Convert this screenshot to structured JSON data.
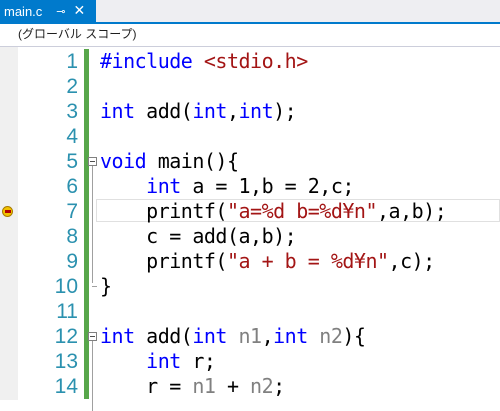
{
  "tab": {
    "name": "main.c",
    "pin_icon": "pin-icon",
    "close_icon": "close-icon"
  },
  "scope": {
    "label": "(グローバル スコープ)"
  },
  "colors": {
    "keyword": "#0000ff",
    "string": "#a31515",
    "line_number": "#2b91af",
    "change_bar": "#57a64a",
    "accent": "#007acc"
  },
  "editor": {
    "lines": [
      {
        "num": "1",
        "code": "#include <stdio.h>",
        "parts": [
          {
            "t": "#include ",
            "c": "kw"
          },
          {
            "t": "<stdio.h>",
            "c": "str"
          }
        ]
      },
      {
        "num": "2",
        "code": "",
        "parts": []
      },
      {
        "num": "3",
        "code": "int add(int,int);",
        "parts": [
          {
            "t": "int",
            "c": "kw"
          },
          {
            "t": " add(",
            "c": ""
          },
          {
            "t": "int",
            "c": "kw"
          },
          {
            "t": ",",
            "c": ""
          },
          {
            "t": "int",
            "c": "kw"
          },
          {
            "t": ");",
            "c": ""
          }
        ]
      },
      {
        "num": "4",
        "code": "",
        "parts": []
      },
      {
        "num": "5",
        "code": "void main(){",
        "parts": [
          {
            "t": "void",
            "c": "kw"
          },
          {
            "t": " main(){",
            "c": ""
          }
        ],
        "fold": true
      },
      {
        "num": "6",
        "code": "    int a = 1,b = 2,c;",
        "parts": [
          {
            "t": "    ",
            "c": ""
          },
          {
            "t": "int",
            "c": "kw"
          },
          {
            "t": " a = 1,b = 2,c;",
            "c": ""
          }
        ]
      },
      {
        "num": "7",
        "code": "    printf(\"a=%d b=%d¥n\",a,b);",
        "parts": [
          {
            "t": "    printf(",
            "c": ""
          },
          {
            "t": "\"a=%d b=%d¥n\"",
            "c": "str"
          },
          {
            "t": ",a,b);",
            "c": ""
          }
        ],
        "breakpoint": true,
        "current": true
      },
      {
        "num": "8",
        "code": "    c = add(a,b);",
        "parts": [
          {
            "t": "    c = add(a,b);",
            "c": ""
          }
        ]
      },
      {
        "num": "9",
        "code": "    printf(\"a + b = %d¥n\",c);",
        "parts": [
          {
            "t": "    printf(",
            "c": ""
          },
          {
            "t": "\"a + b = %d¥n\"",
            "c": "str"
          },
          {
            "t": ",c);",
            "c": ""
          }
        ]
      },
      {
        "num": "10",
        "code": "}",
        "parts": [
          {
            "t": "}",
            "c": ""
          }
        ]
      },
      {
        "num": "11",
        "code": "",
        "parts": []
      },
      {
        "num": "12",
        "code": "int add(int n1,int n2){",
        "parts": [
          {
            "t": "int",
            "c": "kw"
          },
          {
            "t": " add(",
            "c": ""
          },
          {
            "t": "int",
            "c": "kw"
          },
          {
            "t": " n1",
            "c": "par"
          },
          {
            "t": ",",
            "c": ""
          },
          {
            "t": "int",
            "c": "kw"
          },
          {
            "t": " n2",
            "c": "par"
          },
          {
            "t": "){",
            "c": ""
          }
        ],
        "fold": true
      },
      {
        "num": "13",
        "code": "    int r;",
        "parts": [
          {
            "t": "    ",
            "c": ""
          },
          {
            "t": "int",
            "c": "kw"
          },
          {
            "t": " r;",
            "c": ""
          }
        ]
      },
      {
        "num": "14",
        "code": "    r = n1 + n2;",
        "parts": [
          {
            "t": "    r = ",
            "c": ""
          },
          {
            "t": "n1",
            "c": "par"
          },
          {
            "t": " + ",
            "c": ""
          },
          {
            "t": "n2",
            "c": "par"
          },
          {
            "t": ";",
            "c": ""
          }
        ]
      }
    ]
  }
}
